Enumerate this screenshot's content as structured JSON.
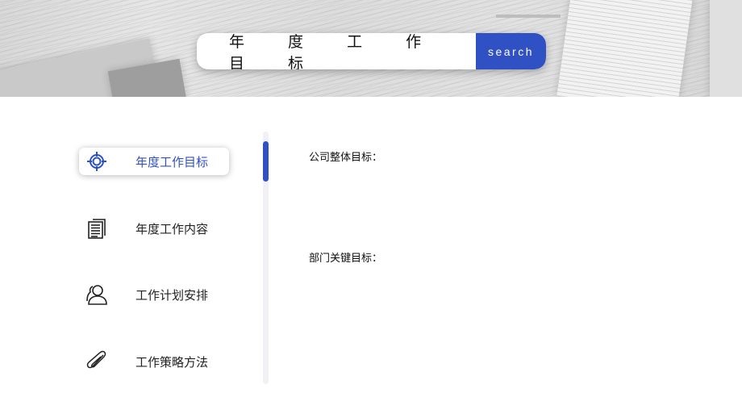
{
  "header": {
    "title": "年 度 工 作 目 标",
    "search_button_label": "search",
    "accent_color": "#2f51c4"
  },
  "nav": {
    "items": [
      {
        "label": "年度工作目标",
        "icon": "target-icon",
        "active": true
      },
      {
        "label": "年度工作内容",
        "icon": "document-icon",
        "active": false
      },
      {
        "label": "工作计划安排",
        "icon": "people-icon",
        "active": false
      },
      {
        "label": "工作策略方法",
        "icon": "paperclip-icon",
        "active": false
      }
    ]
  },
  "scrollbar": {
    "position_fraction": 0.04
  },
  "content": {
    "sections": [
      {
        "label": "公司整体目标："
      },
      {
        "label": "部门关键目标："
      }
    ]
  }
}
